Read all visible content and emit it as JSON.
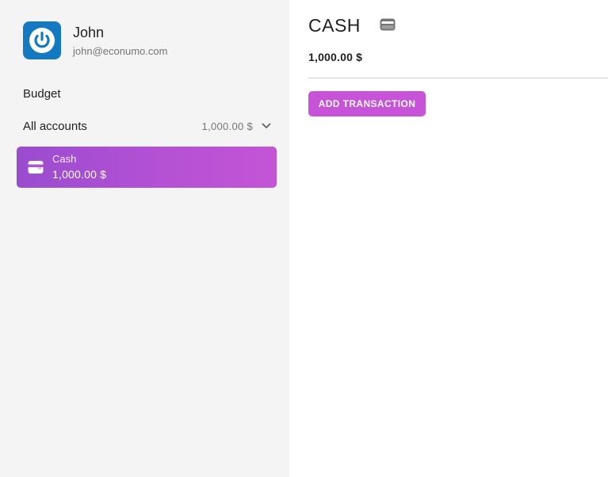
{
  "user": {
    "name": "John",
    "email": "john@econumo.com"
  },
  "sidebar": {
    "budget_label": "Budget",
    "accounts_label": "All accounts",
    "accounts_total": "1,000.00 $",
    "accounts": [
      {
        "name": "Cash",
        "balance": "1,000.00 $",
        "icon": "wallet-icon"
      }
    ]
  },
  "main": {
    "title": "CASH",
    "title_icon": "wallet-icon",
    "balance": "1,000.00 $",
    "add_transaction_label": "ADD TRANSACTION"
  },
  "colors": {
    "accent": "#c653d8",
    "avatar": "#1479c0",
    "sidebar_bg": "#f4f4f4"
  }
}
